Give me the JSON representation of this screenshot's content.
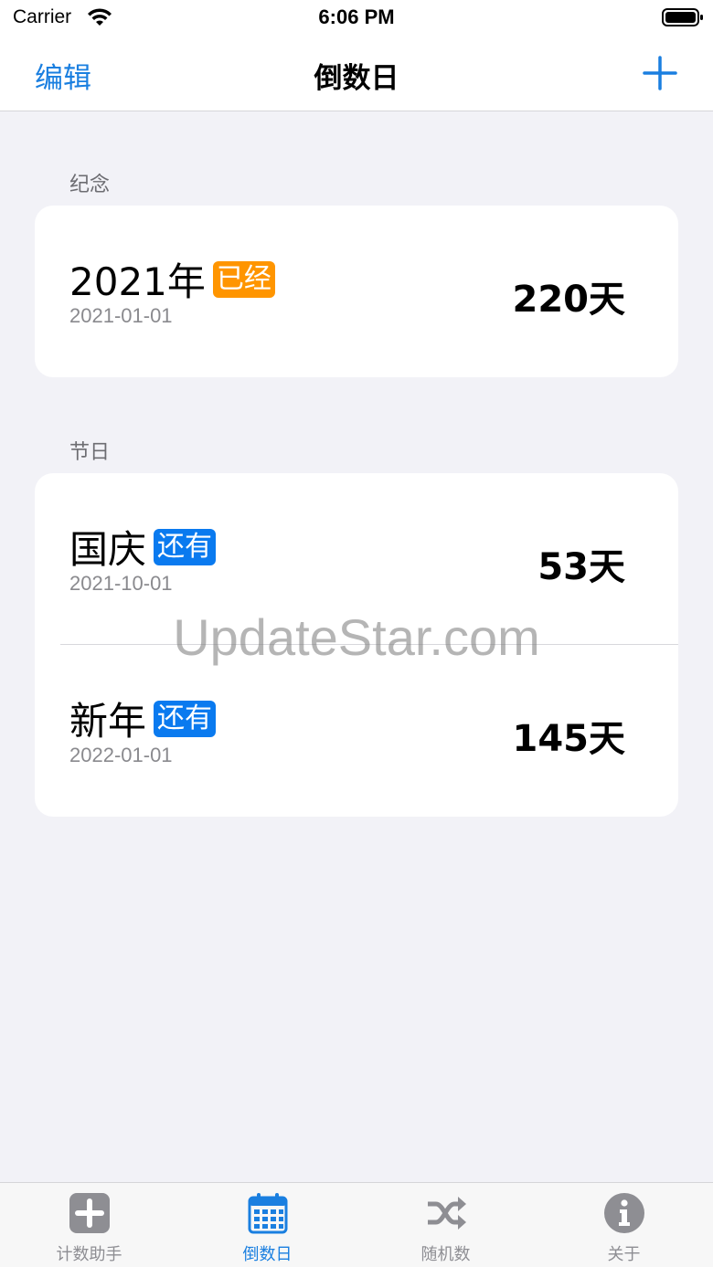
{
  "status_bar": {
    "carrier": "Carrier",
    "time": "6:06 PM"
  },
  "nav": {
    "edit_label": "编辑",
    "title": "倒数日",
    "add_icon": "plus-icon"
  },
  "sections": [
    {
      "header": "纪念",
      "rows": [
        {
          "title": "2021年",
          "badge": "已经",
          "badge_color": "#FF9500",
          "date": "2021-01-01",
          "days": "220天"
        }
      ]
    },
    {
      "header": "节日",
      "rows": [
        {
          "title": "国庆",
          "badge": "还有",
          "badge_color": "#0A7AEF",
          "date": "2021-10-01",
          "days": "53天"
        },
        {
          "title": "新年",
          "badge": "还有",
          "badge_color": "#0A7AEF",
          "date": "2022-01-01",
          "days": "145天"
        }
      ]
    }
  ],
  "watermark": "UpdateStar.com",
  "tab_bar": {
    "active_index": 1,
    "accent_color": "#1A7FE0",
    "tabs": [
      {
        "label": "计数助手",
        "icon": "plus-square-icon"
      },
      {
        "label": "倒数日",
        "icon": "calendar-icon"
      },
      {
        "label": "随机数",
        "icon": "shuffle-icon"
      },
      {
        "label": "关于",
        "icon": "info-circle-icon"
      }
    ]
  }
}
